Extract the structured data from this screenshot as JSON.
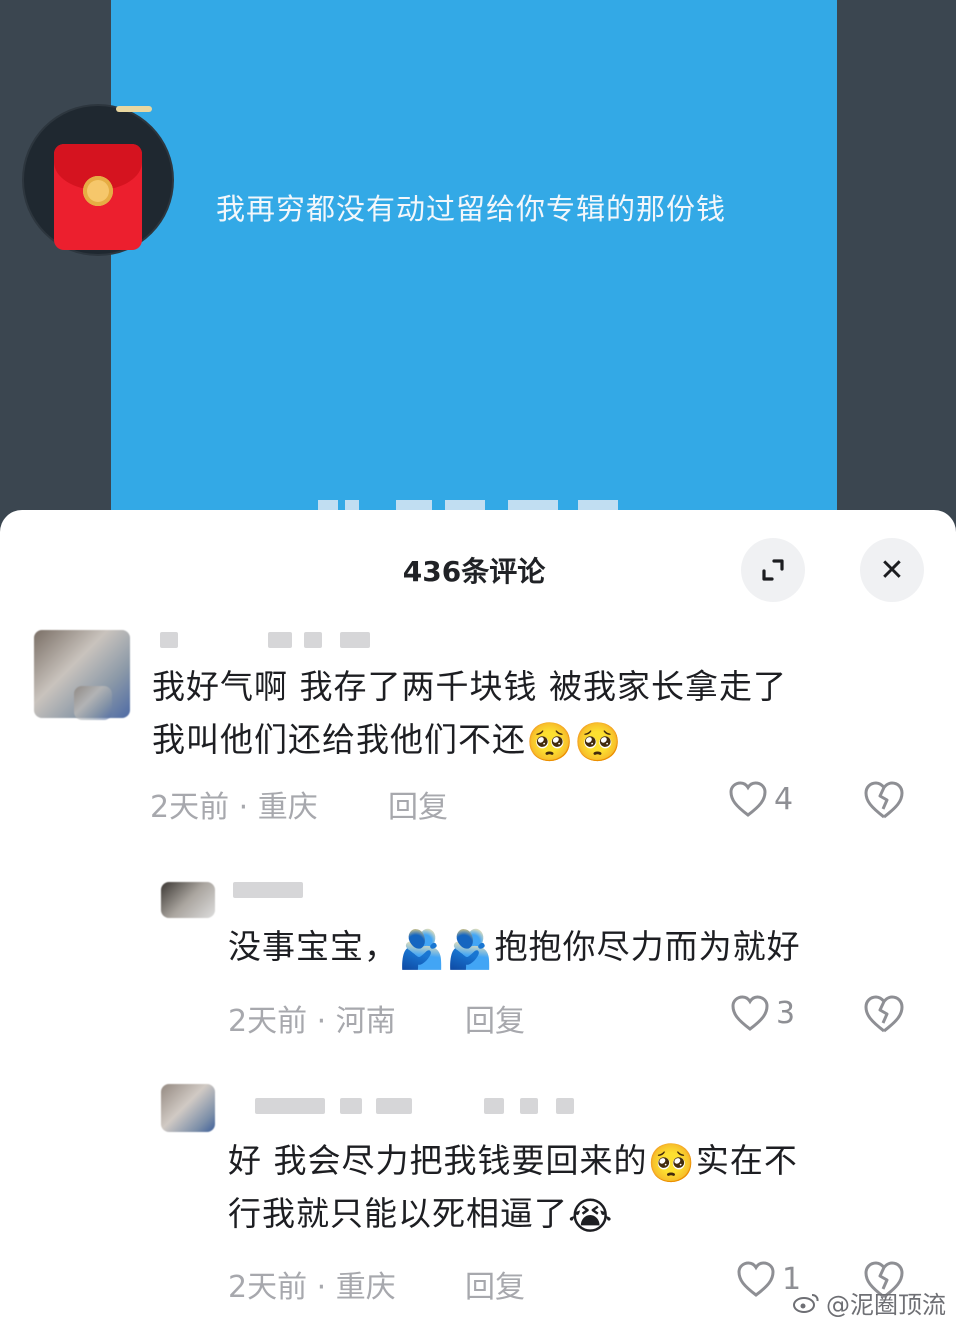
{
  "video": {
    "caption": "我再穷都没有动过留给你专辑的那份钱",
    "avatar_icon": "red-packet-icon"
  },
  "sheet": {
    "title": "436条评论",
    "expand_icon": "expand-icon",
    "close_icon": "close-icon",
    "close_glyph": "✕"
  },
  "comments": [
    {
      "text_line1": "我好气啊 我存了两千块钱 被我家长拿走了",
      "text_line2": "我叫他们还给我他们不还",
      "emojis": [
        "🥺",
        "🥺"
      ],
      "time": "2天前",
      "location": "重庆",
      "reply_label": "回复",
      "likes": "4"
    },
    {
      "text_prefix": "没事宝宝，",
      "emojis": [
        "🫂",
        "🫂"
      ],
      "text_suffix": "抱抱你尽力而为就好",
      "time": "2天前",
      "location": "河南",
      "reply_label": "回复",
      "likes": "3"
    },
    {
      "text_line1_prefix": "好 我会尽力把我钱要回来的",
      "emoji1": "🥺",
      "text_line1_suffix": "实在不",
      "text_line2": "行我就只能以死相逼了",
      "emoji2": "😭",
      "time": "2天前",
      "location": "重庆",
      "reply_label": "回复",
      "likes": "1"
    }
  ],
  "meta_separator": "·",
  "watermark": "@泥圈顶流",
  "colors": {
    "video_blue": "#33a9e6",
    "sheet_bg": "#ffffff",
    "meta_gray": "#a7a8ad"
  }
}
